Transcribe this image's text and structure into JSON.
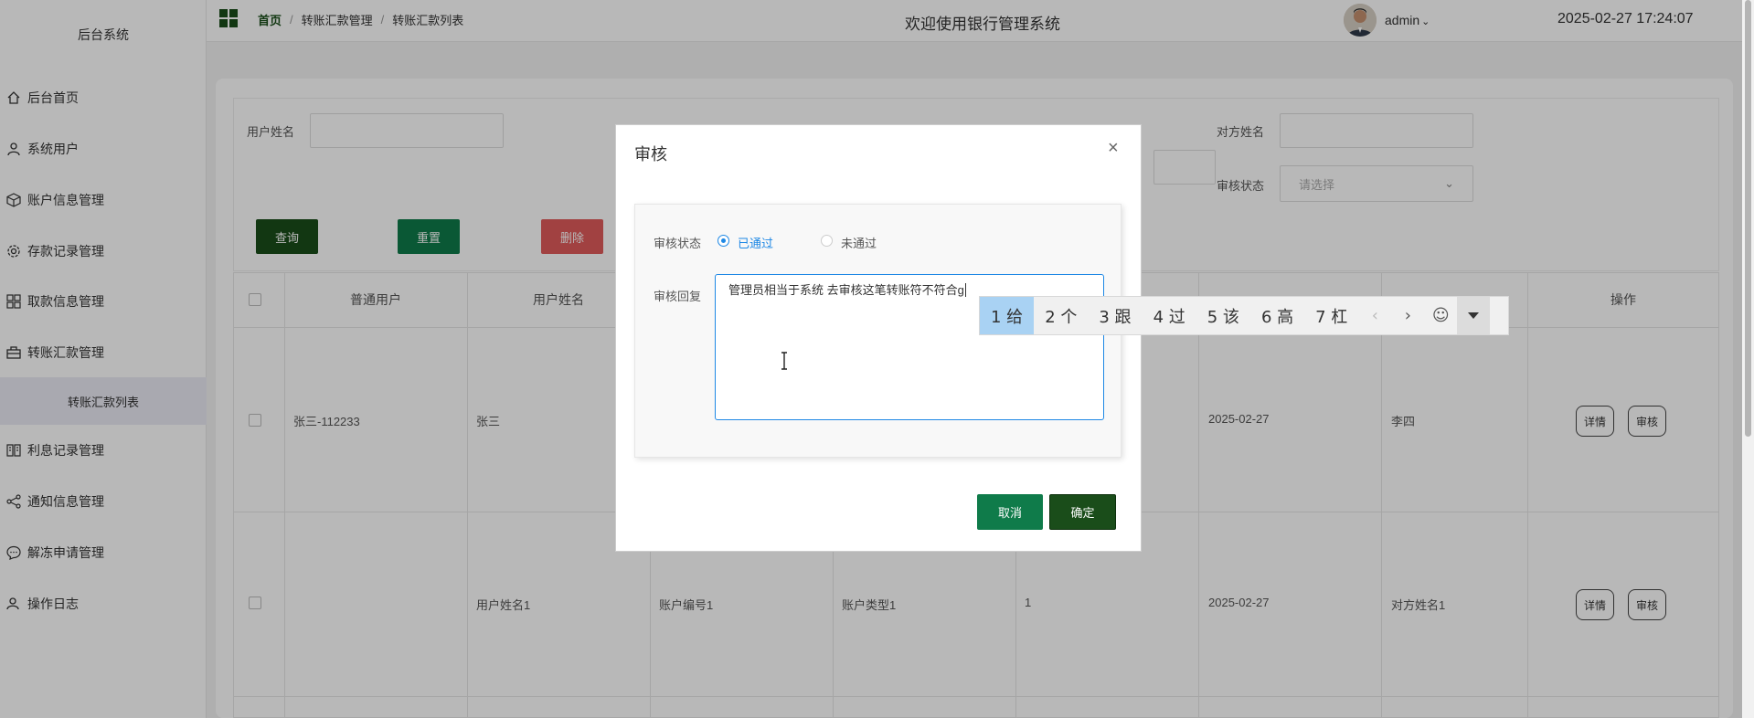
{
  "sidebar": {
    "brand": "后台系统",
    "items": [
      {
        "label": "后台首页",
        "icon": "home-icon"
      },
      {
        "label": "系统用户",
        "icon": "user-icon"
      },
      {
        "label": "账户信息管理",
        "icon": "box-icon"
      },
      {
        "label": "存款记录管理",
        "icon": "gear-icon"
      },
      {
        "label": "取款信息管理",
        "icon": "grid-icon"
      },
      {
        "label": "转账汇款管理",
        "icon": "briefcase-icon"
      },
      {
        "label": "利息记录管理",
        "icon": "book-icon"
      },
      {
        "label": "通知信息管理",
        "icon": "share-icon"
      },
      {
        "label": "解冻申请管理",
        "icon": "chat-icon"
      },
      {
        "label": "操作日志",
        "icon": "person-icon"
      }
    ],
    "submenu_label": "转账汇款列表"
  },
  "header": {
    "breadcrumb": [
      "首页",
      "转账汇款管理",
      "转账汇款列表"
    ],
    "title": "欢迎使用银行管理系统",
    "user": "admin",
    "datetime": "2025-02-27 17:24:07"
  },
  "filters": {
    "user_name_label": "用户姓名",
    "counterparty_label": "对方姓名",
    "audit_status_label": "审核状态",
    "audit_status_placeholder": "请选择",
    "query_label": "查询",
    "reset_label": "重置",
    "delete_label": "删除"
  },
  "table": {
    "headers": [
      "普通用户",
      "用户姓名",
      "操作"
    ],
    "rows": [
      {
        "user": "张三-112233",
        "name": "张三",
        "date": "2025-02-27",
        "counterparty": "李四"
      },
      {
        "user": "",
        "name": "用户姓名1",
        "account_no": "账户编号1",
        "account_type": "账户类型1",
        "amount": "1",
        "date": "2025-02-27",
        "counterparty": "对方姓名1"
      }
    ],
    "detail_label": "详情",
    "audit_label": "审核"
  },
  "modal": {
    "title": "审核",
    "status_label": "审核状态",
    "options": [
      "已通过",
      "未通过"
    ],
    "selected_option": "已通过",
    "reply_label": "审核回复",
    "reply_value": "管理员相当于系统 去审核这笔转账符不符合g",
    "cancel_label": "取消",
    "confirm_label": "确定"
  },
  "ime": {
    "candidates": [
      "1 给",
      "2 个",
      "3 跟",
      "4 过",
      "5 该",
      "6 高",
      "7 杠"
    ],
    "selected_index": 0
  },
  "colors": {
    "accent_dark_green": "#1a4d1a",
    "accent_green": "#0f7b4a",
    "danger": "#e05a5a",
    "focus_blue": "#1e88e5"
  }
}
